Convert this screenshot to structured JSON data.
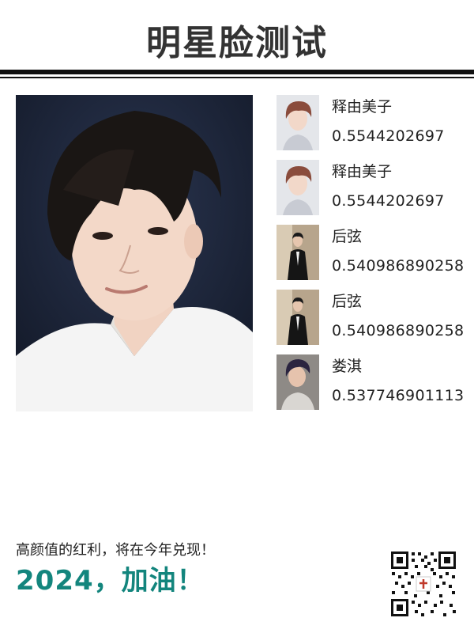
{
  "header": {
    "title": "明星脸测试"
  },
  "matches": [
    {
      "name": "释由美子",
      "score": "0.5544202697"
    },
    {
      "name": "释由美子",
      "score": "0.5544202697"
    },
    {
      "name": "后弦",
      "score": "0.540986890258"
    },
    {
      "name": "后弦",
      "score": "0.540986890258"
    },
    {
      "name": "娄淇",
      "score": "0.537746901113"
    }
  ],
  "footer": {
    "slogan": "高颜值的红利，将在今年兑现！",
    "cheer": "2024，加油！"
  },
  "colors": {
    "accent": "#13857d",
    "title": "#333333",
    "rule": "#111111"
  }
}
